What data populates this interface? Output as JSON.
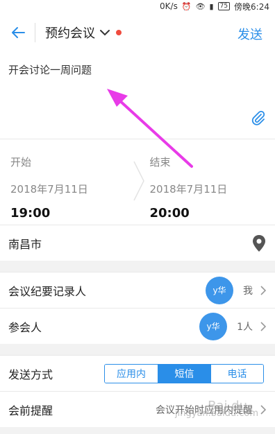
{
  "status_bar": {
    "speed": "0K/s",
    "icons": [
      "alarm-icon",
      "eye-icon",
      "signal-icon"
    ],
    "battery": "75",
    "time": "傍晚6:24"
  },
  "header": {
    "title": "预约会议",
    "send_label": "发送",
    "accent_color": "#2a8ee8"
  },
  "topic": {
    "text": "开会讨论一周问题"
  },
  "time": {
    "start_label": "开始",
    "start_date": "2018年7月11日",
    "start_time": "19:00",
    "end_label": "结束",
    "end_date": "2018年7月11日",
    "end_time": "20:00"
  },
  "location": {
    "text": "南昌市"
  },
  "recorder": {
    "label": "会议纪要记录人",
    "avatar": "y华",
    "value": "我"
  },
  "attendees": {
    "label": "参会人",
    "avatar": "y华",
    "value": "1人"
  },
  "send_method": {
    "label": "发送方式",
    "options": [
      "应用内",
      "短信",
      "电话"
    ],
    "selected": "短信"
  },
  "reminder": {
    "label": "会前提醒",
    "value": "会议开始时应用内提醒"
  },
  "watermark": {
    "text": "jingyan.baidu.com"
  }
}
